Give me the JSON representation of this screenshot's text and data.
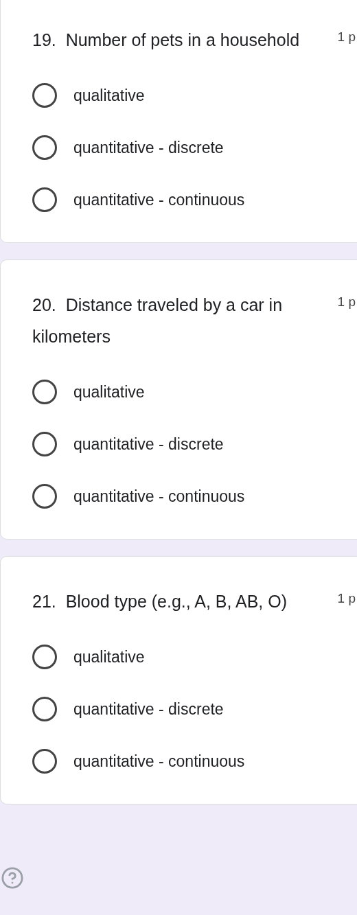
{
  "questions": [
    {
      "title": "19.  Number of pets in a household",
      "points": "1 p",
      "options": [
        {
          "label": "qualitative",
          "selected": false
        },
        {
          "label": "quantitative - discrete",
          "selected": false
        },
        {
          "label": "quantitative - continuous",
          "selected": false
        }
      ]
    },
    {
      "title": "20.  Distance traveled by a car in kilometers",
      "points": "1 p",
      "options": [
        {
          "label": "qualitative",
          "selected": false
        },
        {
          "label": "quantitative - discrete",
          "selected": false
        },
        {
          "label": "quantitative - continuous",
          "selected": false
        }
      ]
    },
    {
      "title": "21.  Blood type (e.g., A, B, AB, O)",
      "points": "1 p",
      "options": [
        {
          "label": "qualitative",
          "selected": false
        },
        {
          "label": "quantitative - discrete",
          "selected": false
        },
        {
          "label": "quantitative - continuous",
          "selected": false
        }
      ]
    }
  ]
}
